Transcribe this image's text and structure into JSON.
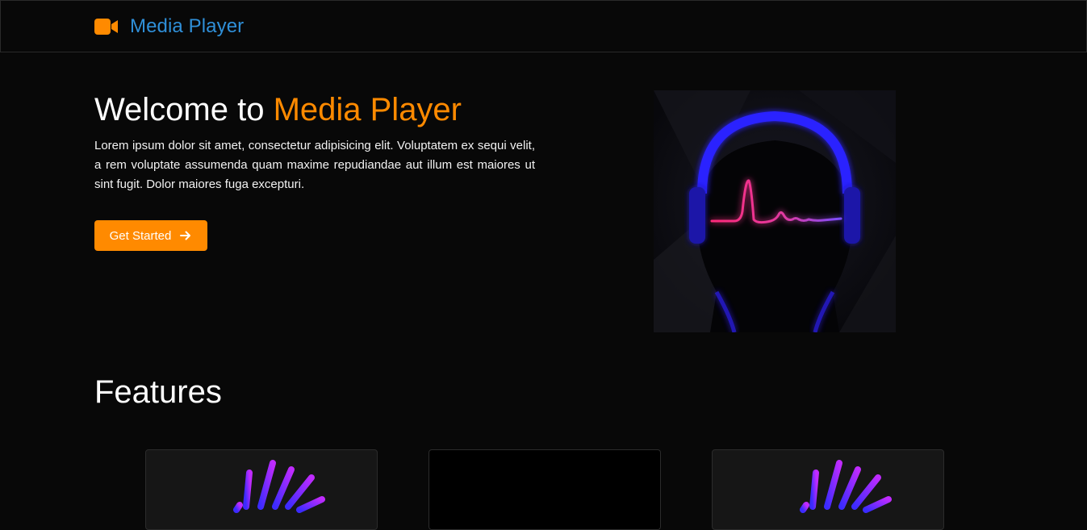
{
  "navbar": {
    "brand_text": "Media Player",
    "brand_icon": "video-camera-icon",
    "brand_icon_color": "#ff8a00",
    "brand_text_color": "#2f8fd8"
  },
  "hero": {
    "title_prefix": "Welcome to ",
    "title_accent": "Media Player",
    "description": "Lorem ipsum dolor sit amet, consectetur adipisicing elit. Voluptatem ex sequi velit, a rem voluptate assumenda quam maxime repudiandae aut illum est maiores ut sint fugit. Dolor maiores fuga excepturi.",
    "button_label": "Get Started",
    "button_icon": "arrow-right-icon",
    "accent_color": "#ff8a00",
    "image": "headphones-heartbeat-illustration"
  },
  "features": {
    "title": "Features",
    "cards": [
      {
        "image": "sound-wave-fan-icon"
      },
      {
        "image": "blank-dark-panel"
      },
      {
        "image": "sound-wave-fan-icon"
      }
    ]
  }
}
